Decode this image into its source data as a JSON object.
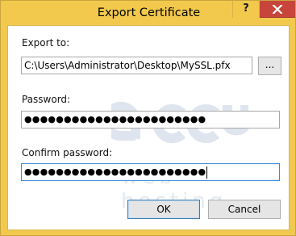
{
  "window": {
    "title": "Export Certificate",
    "help_label": "?",
    "close_icon": "close-icon"
  },
  "form": {
    "export_to_label": "Export to:",
    "export_to_value": "C:\\Users\\Administrator\\Desktop\\MySSL.pfx",
    "browse_label": "...",
    "password_label": "Password:",
    "password_value": "●●●●●●●●●●●●●●●●●●●●●●●",
    "confirm_label": "Confirm password:",
    "confirm_value": "●●●●●●●●●●●●●●●●●●●●●●●"
  },
  "buttons": {
    "ok_label": "OK",
    "cancel_label": "Cancel"
  },
  "watermark": {
    "brand": "accu",
    "tagline": "web hosting"
  },
  "colors": {
    "frame": "#f3c94d",
    "close": "#c7453a",
    "focus": "#3b8ad6",
    "watermark": "#dfe5ee"
  }
}
